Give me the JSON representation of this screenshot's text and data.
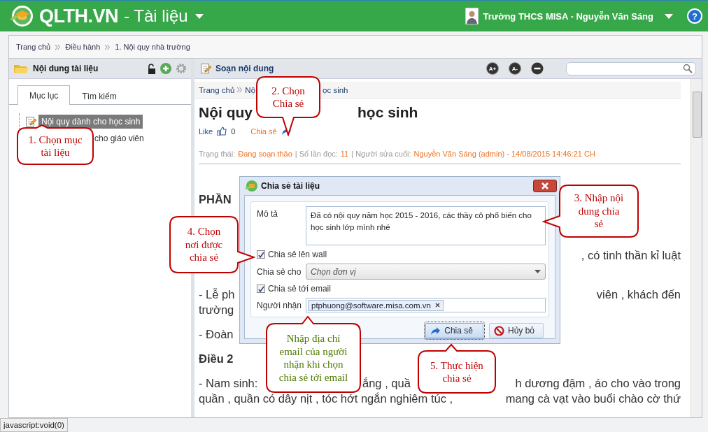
{
  "header": {
    "logo": "QLTH.VN",
    "module": "- Tài liệu",
    "user": "Trường THCS MISA - Nguyễn Văn Sáng",
    "help": "?"
  },
  "breadcrumb": [
    "Trang chủ",
    "Điều hành",
    "1. Nội quy nhà trường"
  ],
  "left_panel": {
    "title": "Nội dung tài liệu",
    "tabs": [
      {
        "label": "Mục lục",
        "selected": true
      },
      {
        "label": "Tìm kiếm",
        "selected": false
      }
    ],
    "tree": [
      {
        "label": "Nội quy dành cho học sinh",
        "selected": true
      },
      {
        "label": "cho giáo viên",
        "selected": false
      }
    ]
  },
  "toolbar": {
    "title": "Soạn nội dung",
    "font_buttons": [
      "A+",
      "A-"
    ]
  },
  "document": {
    "breadcrumb": [
      "Trang chủ",
      "Nộ"
    ],
    "breadcrumb_tail": "ọc sinh",
    "title_parts": [
      "Nội quy",
      "học sinh"
    ],
    "like_label": "Like",
    "like_count": "0",
    "share_label": "Chia sẻ",
    "status": [
      {
        "label": "Trạng thái:",
        "value": "Đang soạn thảo"
      },
      {
        "label": "| Số lần đọc:",
        "value": "11"
      },
      {
        "label": "| Người sửa cuối:",
        "value": "Nguyễn Văn Sáng (admin) - 14/08/2015 14:46:21 CH"
      }
    ],
    "lines": [
      {
        "kind": "heading",
        "parts": [
          "PHẦN"
        ]
      },
      {
        "kind": "tail",
        "parts": [
          ", có tinh thần kỉ luật"
        ]
      },
      {
        "kind": "gap",
        "parts": [
          "- Lễ ph",
          "viên , khách đến"
        ]
      },
      {
        "kind": "cont",
        "parts": [
          "trường"
        ]
      },
      {
        "kind": "para",
        "parts": [
          "- Đoàn"
        ]
      },
      {
        "kind": "heading-para",
        "parts": [
          "Điều 2"
        ]
      },
      {
        "kind": "para",
        "parts": [
          "- Nam sinh:",
          "ắng , quầ",
          "h dương đậm , áo cho vào trong"
        ]
      },
      {
        "kind": "cont",
        "parts": [
          "quần , quần có dây nịt , tóc hớt ngắn nghiêm túc ,",
          "mang cà vạt vào buổi chào cờ thứ"
        ]
      }
    ]
  },
  "dialog": {
    "title": "Chia sẻ tài liệu",
    "description_label": "Mô tả",
    "description": "Đã có nội quy năm học 2015 - 2016, các thầy cô phổ biến cho học sinh lớp mình nhé",
    "share_wall": {
      "label": "Chia sẻ lên wall",
      "checked": true
    },
    "share_to_label": "Chia sẻ cho",
    "share_to_placeholder": "Chọn đơn vị",
    "share_email": {
      "label": "Chia sẻ tới email",
      "checked": true
    },
    "recipient_label": "Người nhận",
    "recipients": [
      "ptphuong@software.misa.com.vn"
    ],
    "buttons": [
      {
        "label": "Chia sẻ",
        "kind": "primary"
      },
      {
        "label": "Hủy bỏ",
        "kind": "cancel"
      }
    ]
  },
  "callouts": [
    {
      "text": "1. Chọn mục\ntài liệu",
      "color": "#c00000"
    },
    {
      "text": "2. Chọn\nChia sẻ",
      "color": "#c00000"
    },
    {
      "text": "3. Nhập nội\ndung chia\nsẻ",
      "color": "#c00000"
    },
    {
      "text": "4. Chọn\nnơi được\nchia sẻ",
      "color": "#c00000"
    },
    {
      "text": "Nhập địa chỉ\nemail của người\nnhận khi chọn\nchia sẻ tới email",
      "color": "#4d7a00"
    },
    {
      "text": "5. Thực hiện\nchia sẻ",
      "color": "#c00000"
    }
  ],
  "status_bar": "javascript:void(0)"
}
